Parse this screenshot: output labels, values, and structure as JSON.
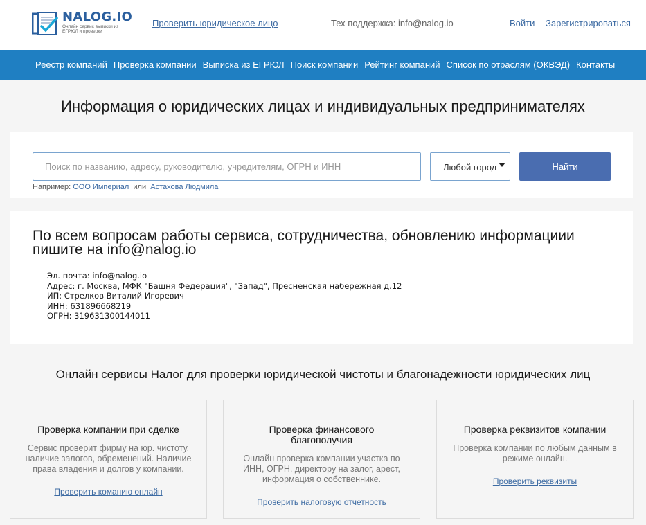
{
  "header": {
    "logo": {
      "title": "NALOG.IO",
      "subtitle_line1": "Онлайн сервис выписки из",
      "subtitle_line2": "ЕГРЮЛ и проверки"
    },
    "check_entity_link": "Проверить юридическое лицо",
    "support_text": "Тех поддержка: info@nalog.io",
    "login_link": "Войти",
    "register_link": "Зарегистрироваться"
  },
  "nav": {
    "items": [
      "Реестр компаний",
      "Проверка компании",
      "Выписка из ЕГРЮЛ",
      "Поиск компании",
      "Рейтинг компаний",
      "Список по отраслям (ОКВЭД)",
      "Контакты"
    ]
  },
  "page_title": "Информация о юридических лицах и индивидуальных предпринимателях",
  "search": {
    "placeholder": "Поиск по названию, адресу, руководителю, учредителям, ОГРН и ИНН",
    "value": "",
    "city_selected": "Любой город",
    "button_label": "Найти",
    "hint_prefix": "Например:",
    "hint_example1": "ООО Империал",
    "hint_or": "или",
    "hint_example2": "Астахова Людмила"
  },
  "info": {
    "title": "По всем вопросам работы сервиса, сотрудничества, обновлению информациии пишите на info@nalog.io",
    "lines": [
      "Эл. почта: info@nalog.io",
      "Адрес: г. Москва, МФК \"Башня Федерация\", \"Запад\", Пресненская набережная д.12",
      "ИП: Стрелков Виталий Игоревич",
      "ИНН: 631896668219",
      "ОГРН: 319631300144011"
    ]
  },
  "services": {
    "title": "Онлайн сервисы Налог для проверки юридической чистоты и благонадежности юридических лиц",
    "cards": [
      {
        "title": "Проверка компании при сделке",
        "description": "Сервис проверит фирму на юр. чистоту, наличие залогов, обременений. Наличие права владения и долгов у компании.",
        "link": "Проверить команию онлайн"
      },
      {
        "title": "Проверка финансового благополучия",
        "description": "Онлайн проверка компании участка по ИНН, ОГРН, директору на залог, арест, информация о собственнике.",
        "link": "Проверить налоговую отчетность"
      },
      {
        "title": "Проверка реквизитов компании",
        "description": "Проверка компании по любым данным в режиме онлайн.",
        "link": "Проверить реквизиты"
      }
    ]
  },
  "colors": {
    "nav_bg": "#1f7fc2",
    "button_bg": "#4a6db0",
    "link": "#3d6ba3",
    "logo_blue": "#2b5f9e"
  }
}
